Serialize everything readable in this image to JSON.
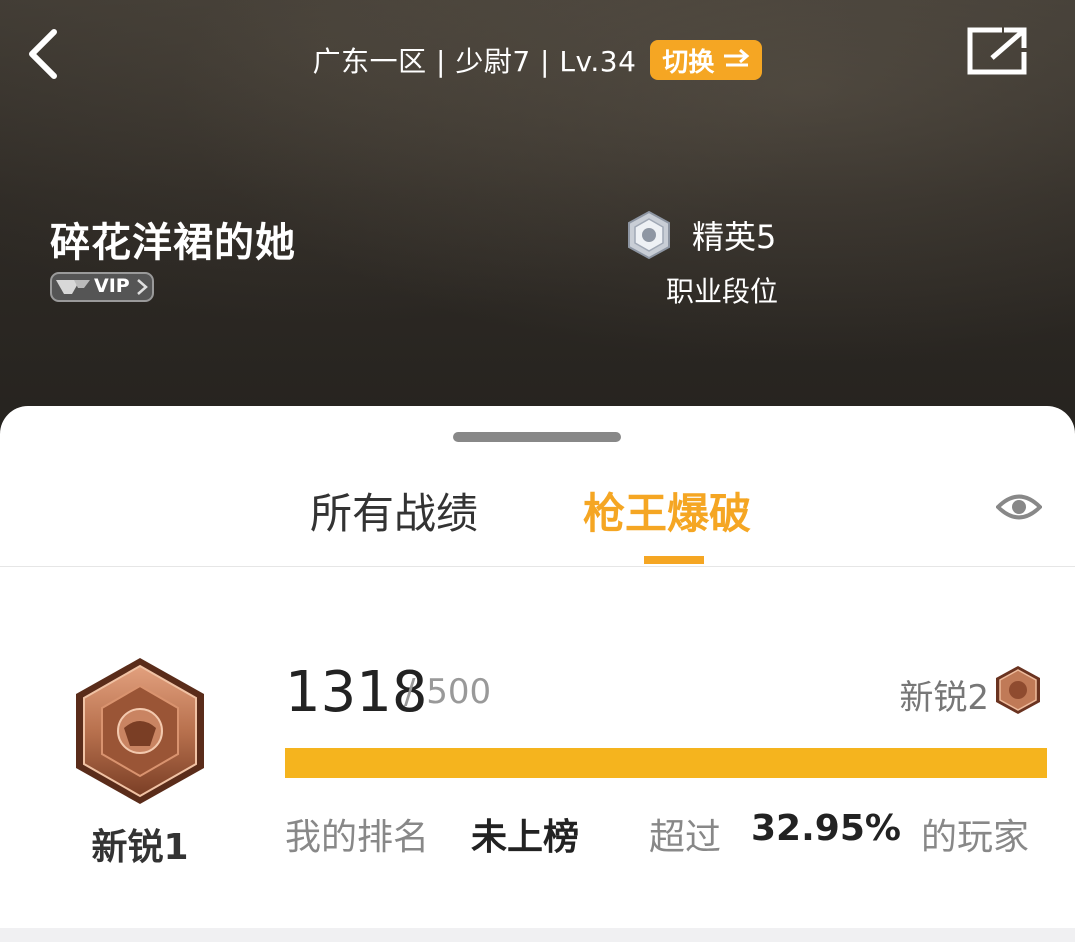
{
  "header": {
    "server_info": "广东一区 | 少尉7 | Lv.34",
    "switch_label": "切换",
    "switch_icon": "swap-arrows-icon",
    "back_icon": "chevron-left-icon",
    "share_icon": "share-external-icon",
    "player_name": "碎花洋裙的她",
    "vip_badge": "VIP",
    "career_rank": "精英5",
    "career_rank_label": "职业段位"
  },
  "tabs": {
    "items": [
      {
        "label": "所有战绩",
        "active": false
      },
      {
        "label": "枪王爆破",
        "active": true
      }
    ],
    "visibility_icon": "eye-icon"
  },
  "mode_stats": {
    "current_rank": "新锐1",
    "score": "1318",
    "score_total": "/ 500",
    "next_rank": "新锐2",
    "progress_fraction": 1.0,
    "my_rank_label": "我的排名",
    "my_rank_value": "未上榜",
    "over_label": "超过",
    "over_value": "32.95%",
    "over_suffix": "的玩家"
  },
  "colors": {
    "accent": "#f5a623",
    "progress": "#f5b41e",
    "bronze": "#b8714e"
  }
}
